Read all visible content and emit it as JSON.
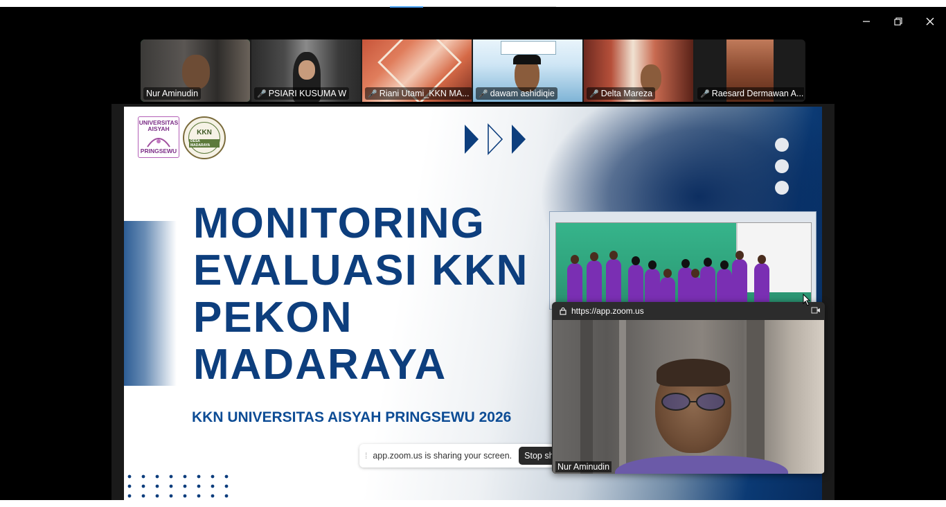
{
  "window": {
    "controls": [
      {
        "name": "minimize",
        "icon": "minimize-icon"
      },
      {
        "name": "restore",
        "icon": "restore-icon"
      },
      {
        "name": "close",
        "icon": "close-icon"
      }
    ]
  },
  "gallery": {
    "participants": [
      {
        "name": "Nur Aminudin",
        "muted": false,
        "active": true
      },
      {
        "name": "PSIARI KUSUMA W",
        "muted": true,
        "active": false
      },
      {
        "name": "Riani Utami_KKN MA...",
        "muted": true,
        "active": false
      },
      {
        "name": "dawam ashidiqie",
        "muted": true,
        "active": false
      },
      {
        "name": "Delta Mareza",
        "muted": true,
        "active": false
      },
      {
        "name": "Raesard Dermawan A...",
        "muted": true,
        "active": false
      }
    ]
  },
  "slide": {
    "logo_ua": {
      "line1": "UNIVERSITAS",
      "line2": "AISYAH",
      "line3": "PRINGSEWU"
    },
    "logo_kkn": {
      "text": "KKN",
      "sub": "DESA MADARAYA"
    },
    "title_lines": [
      "MONITORING",
      "EVALUASI KKN",
      "PEKON",
      "MADARAYA"
    ],
    "subtitle": "KKN UNIVERSITAS AISYAH PRINGSEWU 2026",
    "accent_color": "#0d3e7d"
  },
  "share_bar": {
    "message": "app.zoom.us is sharing your screen.",
    "stop_label": "Stop sharing"
  },
  "pip": {
    "url": "https://app.zoom.us",
    "participant_name": "Nur Aminudin"
  }
}
